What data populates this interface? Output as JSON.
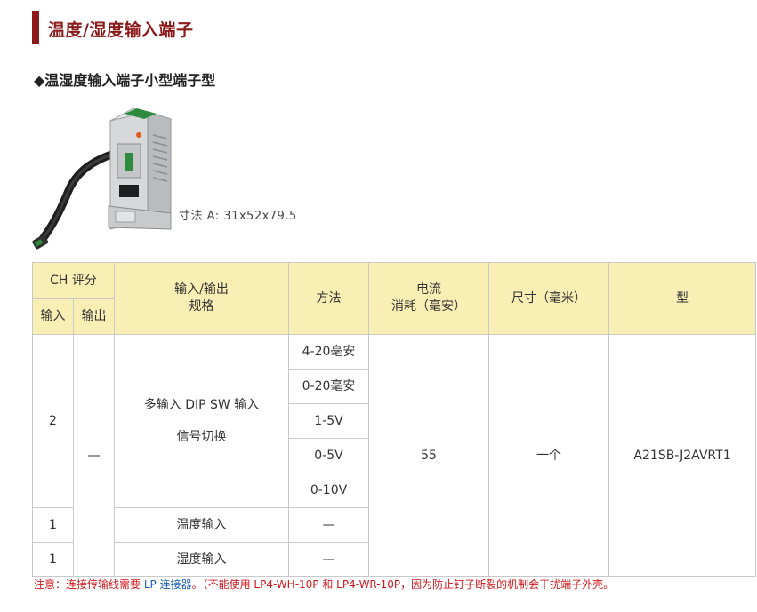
{
  "heading": "温度/湿度输入端子",
  "subheading": "◆温湿度输入端子小型端子型",
  "dimensions": "寸法 A: 31x52x79.5",
  "table": {
    "h_ch": "CH 评分",
    "h_in": "输入",
    "h_out": "输出",
    "h_spec_1": "输入/输出",
    "h_spec_2": "规格",
    "h_method": "方法",
    "h_current_1": "电流",
    "h_current_2": "消耗（毫安）",
    "h_size": "尺寸（毫米）",
    "h_model": "型",
    "rows": [
      {
        "in": "2",
        "spec_1": "多输入 DIP SW 输入",
        "spec_2": "信号切换",
        "methods": [
          "4-20毫安",
          "0-20毫安",
          "1-5V",
          "0-5V",
          "0-10V"
        ]
      },
      {
        "in": "1",
        "spec": "温度输入",
        "method": "—"
      },
      {
        "in": "1",
        "spec": "湿度输入",
        "method": "—"
      }
    ],
    "out": "—",
    "current": "55",
    "size": "一个",
    "model": "A21SB-J2AVRT1"
  },
  "note": {
    "prefix": "注意：连接传输线需要",
    "link": "LP 连接器",
    "suffix": "。（不能使用 LP4-WH-10P 和 LP4-WR-10P，因为防止钉子断裂的机制会干扰端子外壳。"
  },
  "colors": {
    "accent": "#8b1a1a",
    "header_bg": "#f9eeb4",
    "note": "#d0171b",
    "link": "#1a5fb4"
  }
}
